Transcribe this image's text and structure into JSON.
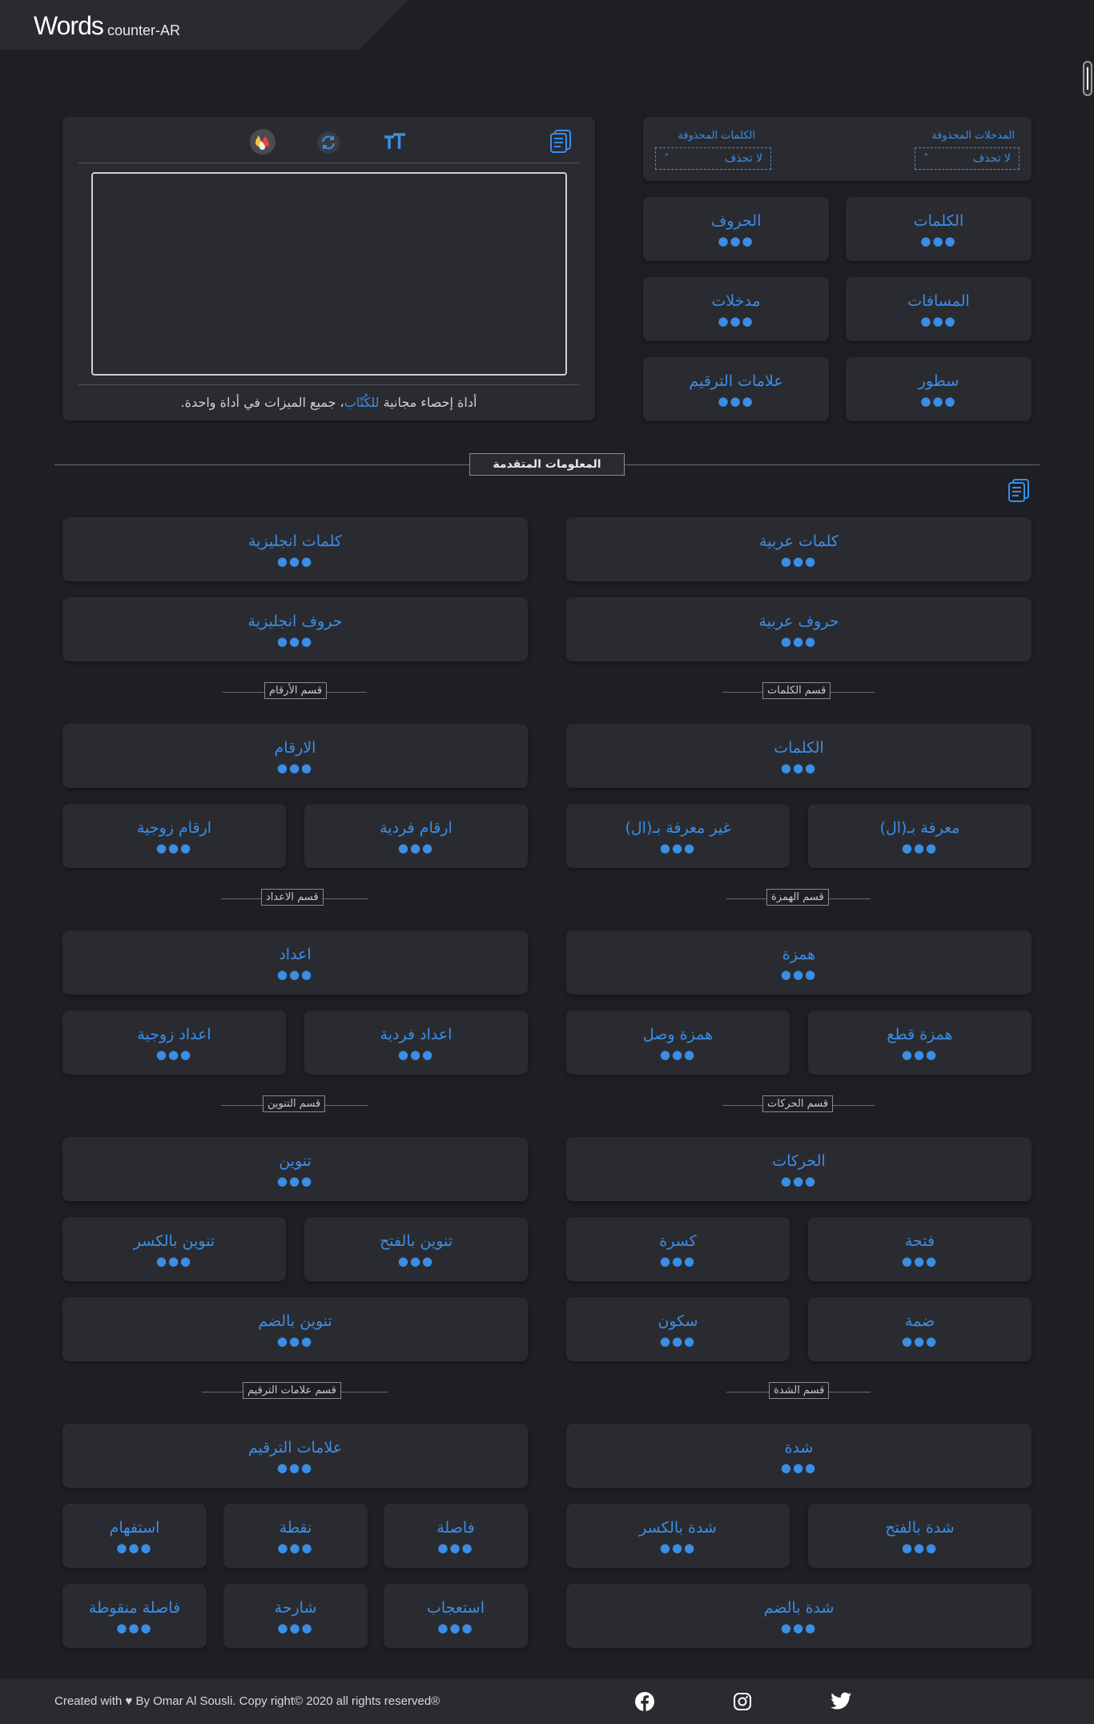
{
  "header": {
    "logo_main": "Words",
    "logo_sub": "counter-AR"
  },
  "top_panel": {
    "saved_inputs_label": "المدخلات المحذوفة",
    "saved_inputs_value": "لا تحذف",
    "saved_words_label": "الكلمات المحذوفة",
    "saved_words_value": "لا تحذف"
  },
  "stats": {
    "words": "الكلمات",
    "letters": "الحروف",
    "spaces": "المسافات",
    "inputs": "مدخلات",
    "lines": "سطور",
    "punctuation": "علامات الترقيم",
    "placeholder_value": "●●●"
  },
  "editor": {
    "text": "",
    "footer_prefix": "أداة إحصاء مجانية ",
    "footer_link": "للكُتّاب",
    "footer_suffix": "، جميع الميزات في أداة واحدة."
  },
  "advanced": {
    "title": "المعلومات المتقدمة",
    "arabic_words": "كلمات عربية",
    "english_words": "كلمات انجليزية",
    "arabic_letters": "حروف عربية",
    "english_letters": "حروف انجليزية",
    "sec_words": "قسم الكلمات",
    "sec_numbers": "قسم الأرقام",
    "words": "الكلمات",
    "numbers": "الارقام",
    "definite": "معرفة بـ(ال)",
    "indefinite": "غير معرفة بـ(ال)",
    "odd_numbers": "ارقام فردية",
    "even_numbers": "ارقام زوجية",
    "sec_hamza": "قسم الهمزة",
    "sec_counts": "قسم الاعداد",
    "hamza": "همزة",
    "counts": "اعداد",
    "hamza_qat": "همزة قطع",
    "hamza_wasl": "همزة وصل",
    "odd_counts": "اعداد فردية",
    "even_counts": "اعداد زوجية",
    "sec_harakat": "قسم الحركات",
    "sec_tanween": "قسم التنوين",
    "harakat": "الحركات",
    "tanween": "تنوين",
    "fatha": "فتحة",
    "kasra": "كسرة",
    "tanween_fath": "تنوين بالفتح",
    "tanween_kasr": "تنوين بالكسر",
    "damma": "ضمة",
    "sukun": "سكون",
    "tanween_damm": "تنوين بالضم",
    "sec_shadda": "قسم الشدة",
    "sec_punct": "قسم علامات الترقيم",
    "shadda": "شدة",
    "punctuation": "علامات الترقيم",
    "shadda_fath": "شدة بالفتح",
    "shadda_kasr": "شدة بالكسر",
    "comma": "فاصلة",
    "period": "نقطة",
    "question": "استفهام",
    "shadda_damm": "شدة بالضم",
    "exclamation": "استعجاب",
    "dash": "شارحة",
    "semicolon": "فاصلة منقوطة"
  },
  "footer": {
    "credit": "Created with ♥ By Omar Al Sousli. Copy right© 2020 all rights reserved®"
  },
  "icons": [
    "copy-icon",
    "text-size-icon",
    "refresh-icon",
    "color-drops-icon",
    "facebook-icon",
    "instagram-icon",
    "twitter-icon"
  ],
  "colors": {
    "accent": "#3a8ee6",
    "background": "#1e1f24",
    "card": "#2a2b31"
  }
}
